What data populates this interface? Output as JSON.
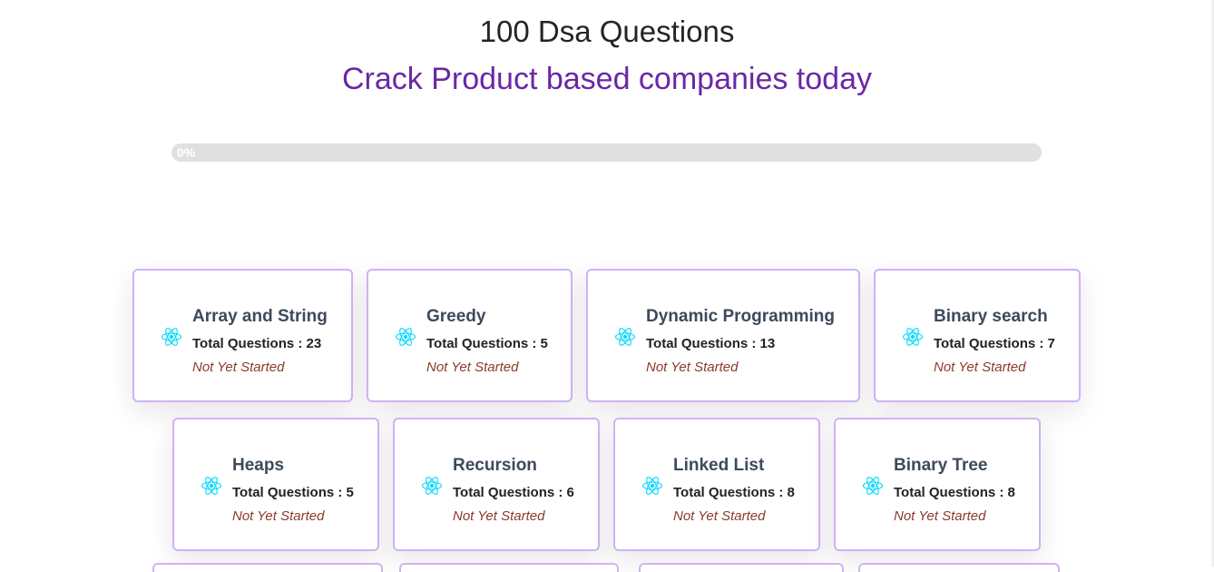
{
  "header": {
    "title": "100 Dsa Questions",
    "subtitle": "Crack Product based companies today"
  },
  "progress": {
    "value_percent": 0,
    "label": "0%"
  },
  "topics": [
    {
      "name": "Array and String",
      "total_label": "Total Questions : 23",
      "status": "Not Yet Started"
    },
    {
      "name": "Greedy",
      "total_label": "Total Questions : 5",
      "status": "Not Yet Started"
    },
    {
      "name": "Dynamic Programming",
      "total_label": "Total Questions : 13",
      "status": "Not Yet Started"
    },
    {
      "name": "Binary search",
      "total_label": "Total Questions : 7",
      "status": "Not Yet Started"
    },
    {
      "name": "Heaps",
      "total_label": "Total Questions : 5",
      "status": "Not Yet Started"
    },
    {
      "name": "Recursion",
      "total_label": "Total Questions : 6",
      "status": "Not Yet Started"
    },
    {
      "name": "Linked List",
      "total_label": "Total Questions : 8",
      "status": "Not Yet Started"
    },
    {
      "name": "Binary Tree",
      "total_label": "Total Questions : 8",
      "status": "Not Yet Started"
    }
  ],
  "icons": {
    "topic_icon": "react-icon"
  },
  "colors": {
    "accent": "#6a27a6",
    "card_border": "#d0b2f5",
    "react_icon": "#00d8ff",
    "status_text": "#8b3a2a"
  }
}
